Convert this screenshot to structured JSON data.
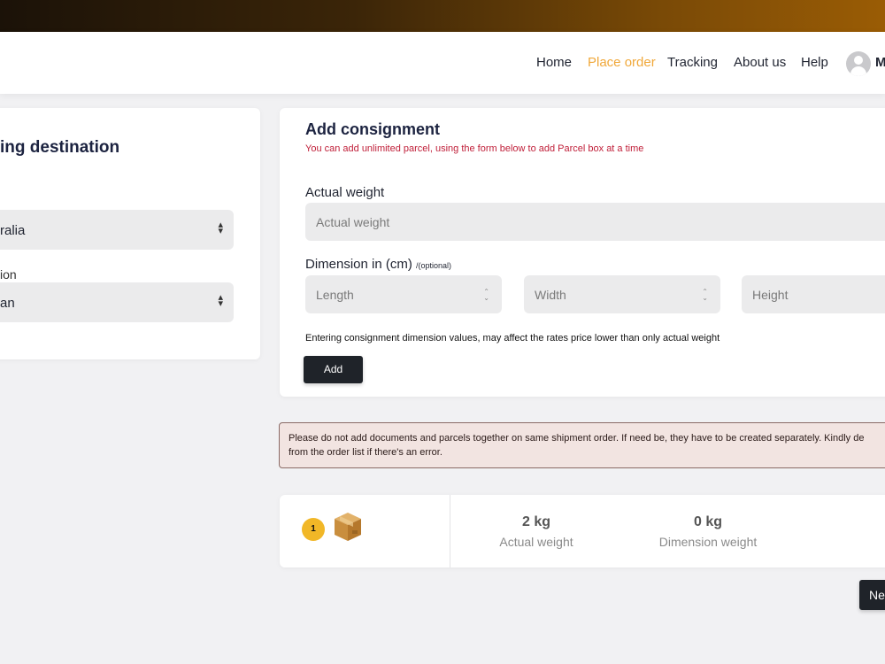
{
  "nav": {
    "links": [
      "Home",
      "Place order",
      "Tracking",
      "About us",
      "Help"
    ],
    "active": "Place order",
    "user_initial": "M"
  },
  "destination": {
    "title": "ing destination",
    "country_value": "ralia",
    "region_label": "ion",
    "region_value": "an"
  },
  "consignment": {
    "title": "Add consignment",
    "subtitle": "You can add unlimited parcel, using the form below to add Parcel box at a time",
    "weight_label": "Actual weight",
    "weight_placeholder": "Actual weight",
    "dimension_label": "Dimension in (cm)",
    "dimension_optional": "/(optional)",
    "length_placeholder": "Length",
    "width_placeholder": "Width",
    "height_placeholder": "Height",
    "note": "Entering consignment dimension values, may affect the rates price lower than only actual weight",
    "add_button": "Add"
  },
  "warning": {
    "line1": "Please do not add documents and parcels together on same shipment order. If need be, they have to be created separately. Kindly de",
    "line2": "from the order list if there's an error."
  },
  "parcel": {
    "index": "1",
    "actual_weight_value": "2 kg",
    "actual_weight_label": "Actual weight",
    "dimension_weight_value": "0 kg",
    "dimension_weight_label": "Dimension weight"
  },
  "next_button": "Ne",
  "colors": {
    "accent": "#f0a83a",
    "dark_button": "#1f2329",
    "error_text": "#c0203a",
    "badge": "#f1b727"
  }
}
